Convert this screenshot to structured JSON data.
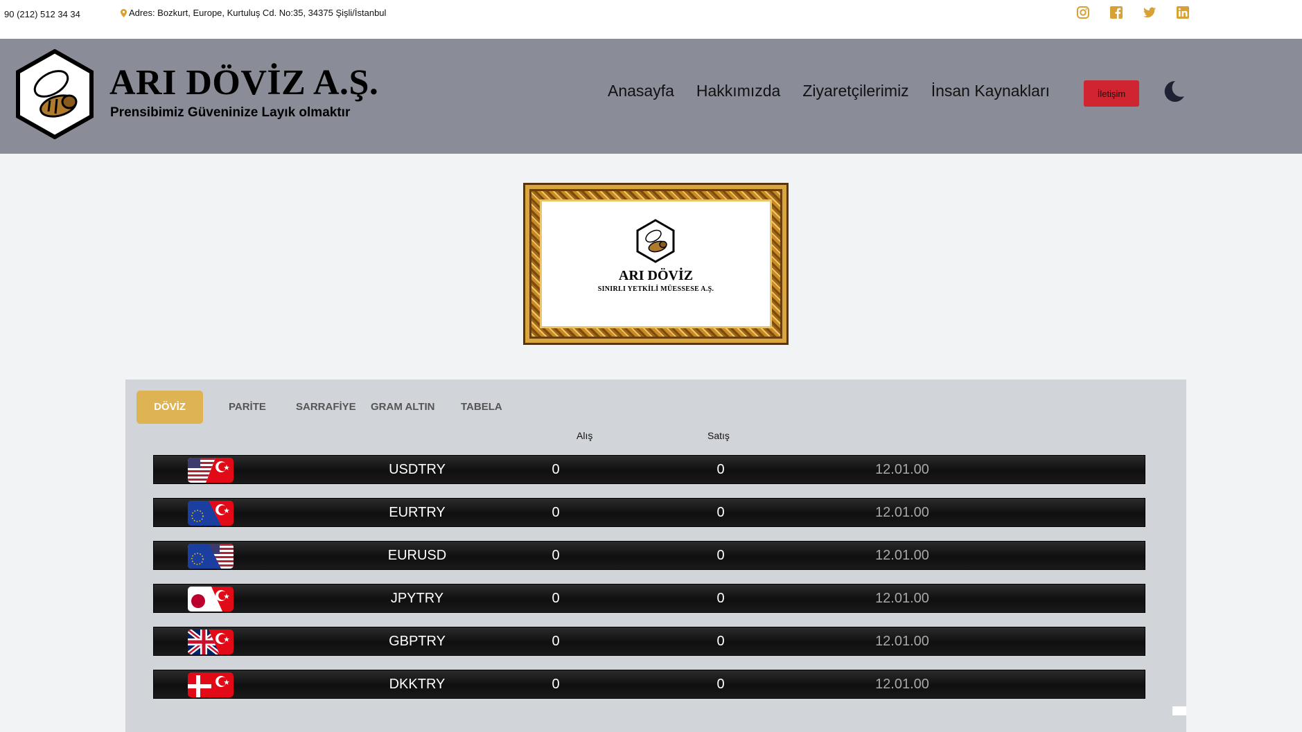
{
  "topbar": {
    "phone": "90 (212) 512 34 34",
    "address": "Adres: Bozkurt, Europe, Kurtuluş Cd. No:35, 34375 Şişli/İstanbul",
    "socials": [
      "instagram-icon",
      "facebook-icon",
      "twitter-icon",
      "linkedin-icon"
    ],
    "accent_color": "#d8a134"
  },
  "header": {
    "brand_name": "ARI DÖVİZ A.Ş.",
    "slogan": "Prensibimiz Güveninize Layık olmaktır",
    "nav": [
      "Anasayfa",
      "Hakkımızda",
      "Ziyaretçilerimiz",
      "İnsan Kaynakları"
    ],
    "contact_label": "İletişim",
    "theme_toggle_icon": "moon-icon",
    "background": "#8a8d98",
    "contact_color": "#d02431"
  },
  "banner": {
    "title": "ARI DÖVİZ",
    "subtitle": "SINIRLI YETKİLİ MÜESSESE A.Ş."
  },
  "rates": {
    "tabs": [
      "DÖVİZ",
      "PARİTE",
      "SARRAFİYE",
      "GRAM ALTIN",
      "TABELA"
    ],
    "active_tab": "DÖVİZ",
    "columns": {
      "buy": "Alış",
      "sell": "Satış"
    },
    "rows": [
      {
        "pair": "USDTRY",
        "buy": "0",
        "sell": "0",
        "time": "12.01.00",
        "flag": "us-tr-flag-icon"
      },
      {
        "pair": "EURTRY",
        "buy": "0",
        "sell": "0",
        "time": "12.01.00",
        "flag": "eu-tr-flag-icon"
      },
      {
        "pair": "EURUSD",
        "buy": "0",
        "sell": "0",
        "time": "12.01.00",
        "flag": "eu-us-flag-icon"
      },
      {
        "pair": "JPYTRY",
        "buy": "0",
        "sell": "0",
        "time": "12.01.00",
        "flag": "jp-tr-flag-icon"
      },
      {
        "pair": "GBPTRY",
        "buy": "0",
        "sell": "0",
        "time": "12.01.00",
        "flag": "gb-tr-flag-icon"
      },
      {
        "pair": "DKKTRY",
        "buy": "0",
        "sell": "0",
        "time": "12.01.00",
        "flag": "dk-tr-flag-icon"
      }
    ]
  }
}
